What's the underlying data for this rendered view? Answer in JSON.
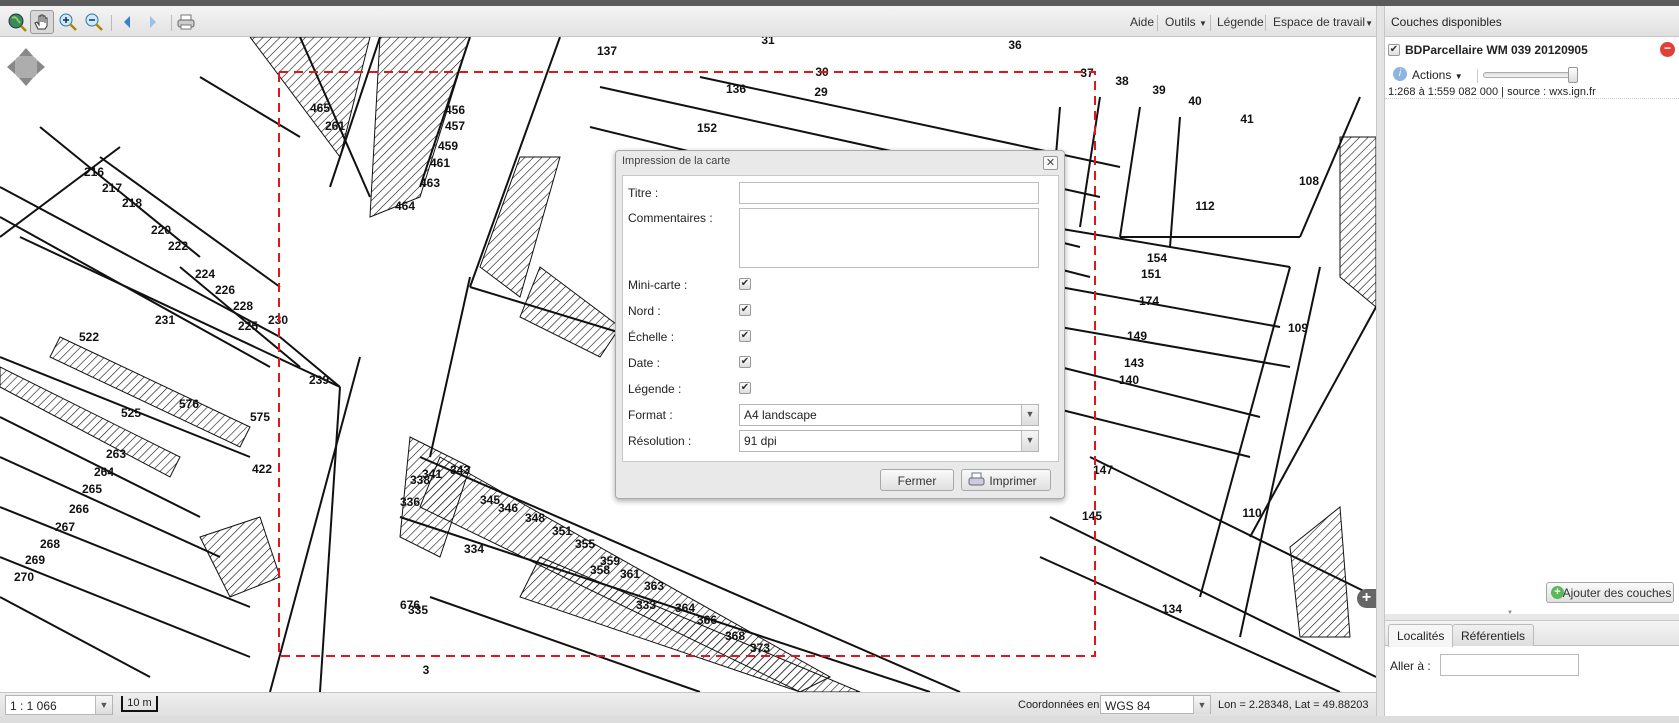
{
  "toolbar": {
    "tools": [
      "globe-zoom-icon",
      "pan-hand-icon",
      "zoom-in-icon",
      "zoom-out-icon",
      "previous-view-icon",
      "next-view-icon",
      "print-icon"
    ],
    "menu": {
      "help": "Aide",
      "tools": "Outils",
      "legend": "Légende",
      "workspace": "Espace de travail"
    }
  },
  "map": {
    "labels": [
      "36",
      "37",
      "38",
      "39",
      "40",
      "41",
      "136",
      "29",
      "30",
      "31",
      "137",
      "152",
      "108",
      "112",
      "154",
      "151",
      "174",
      "149",
      "143",
      "140",
      "109",
      "147",
      "145",
      "110",
      "134",
      "216",
      "217",
      "218",
      "220",
      "222",
      "231",
      "522",
      "576",
      "525",
      "263",
      "264",
      "265",
      "266",
      "267",
      "268",
      "269",
      "270",
      "422",
      "575",
      "334",
      "333",
      "676",
      "3",
      "230",
      "239",
      "225",
      "224",
      "226",
      "228",
      "465",
      "261",
      "456",
      "457",
      "459",
      "461",
      "463",
      "464",
      "345",
      "346",
      "348",
      "351",
      "355",
      "359",
      "361",
      "363",
      "364",
      "366",
      "368",
      "373",
      "338",
      "336",
      "341",
      "343",
      "335",
      "358"
    ],
    "print_extent_color": "#e0161b"
  },
  "status": {
    "scale": "1 : 1 066",
    "scalebar": "10 m",
    "coord_label": "Coordonnées en",
    "crs": "WGS 84",
    "position": "Lon = 2.28348, Lat = 49.88203"
  },
  "layers_panel": {
    "title": "Couches disponibles",
    "layer": {
      "name": "BDParcellaire WM 039 20120905",
      "checked": true,
      "actions": "Actions",
      "opacity": 1.0,
      "scale_range": "1:268 à 1:559 082 000",
      "separator": "|",
      "source": "source : wxs.ign.fr"
    },
    "add_button": "Ajouter des couches"
  },
  "search_panel": {
    "tabs": [
      "Localités",
      "Référentiels"
    ],
    "goto_label": "Aller à :",
    "goto_value": ""
  },
  "print_dialog": {
    "title": "Impression de la carte",
    "fields": {
      "title": "Titre :",
      "comments": "Commentaires :",
      "minimap": "Mini-carte :",
      "north": "Nord :",
      "scale": "Échelle :",
      "date": "Date :",
      "legend": "Légende :",
      "format": "Format :",
      "resolution": "Résolution :"
    },
    "values": {
      "title": "",
      "comments": "",
      "minimap": true,
      "north": true,
      "scale": true,
      "date": true,
      "legend": true,
      "format": "A4 landscape",
      "resolution": "91 dpi"
    },
    "buttons": {
      "close": "Fermer",
      "print": "Imprimer"
    }
  }
}
